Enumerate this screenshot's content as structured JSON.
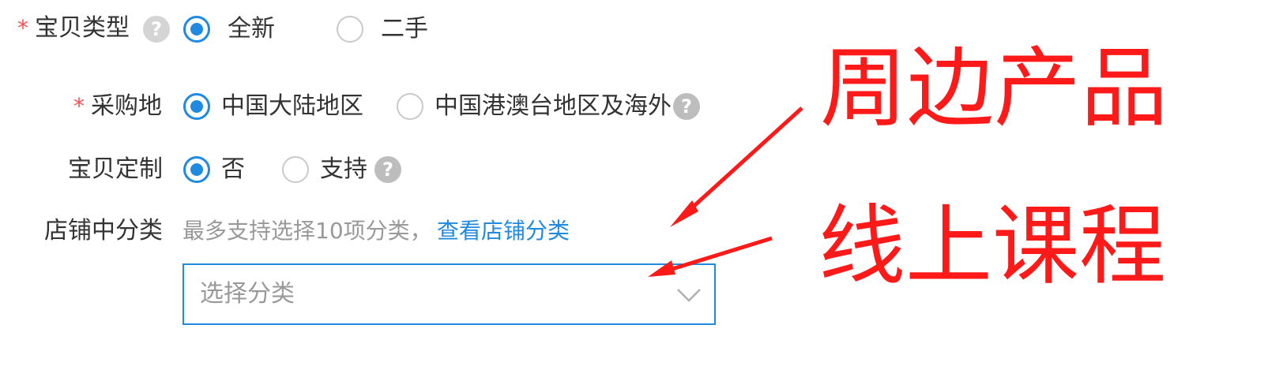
{
  "form": {
    "item_type": {
      "required_mark": "*",
      "label": "宝贝类型",
      "help_icon": "question-circle-icon",
      "options": [
        {
          "label": "全新",
          "checked": true
        },
        {
          "label": "二手",
          "checked": false
        }
      ]
    },
    "purchase_place": {
      "required_mark": "*",
      "label": "采购地",
      "options": [
        {
          "label": "中国大陆地区",
          "checked": true
        },
        {
          "label": "中国港澳台地区及海外",
          "checked": false
        }
      ],
      "help_icon": "question-circle-icon"
    },
    "customization": {
      "label": "宝贝定制",
      "options": [
        {
          "label": "否",
          "checked": true
        },
        {
          "label": "支持",
          "checked": false
        }
      ],
      "help_icon": "question-circle-icon"
    },
    "store_category": {
      "label": "店铺中分类",
      "hint": "最多支持选择10项分类，",
      "link": "查看店铺分类",
      "select_placeholder": "选择分类",
      "chevron_icon": "chevron-down-icon"
    }
  },
  "annotations": {
    "top_text": "周边产品",
    "bottom_text": "线上课程",
    "color": "#ff1a1a"
  },
  "colors": {
    "accent": "#1f8ae0",
    "required": "#ff4d4f",
    "annotation": "#ff1a1a"
  }
}
